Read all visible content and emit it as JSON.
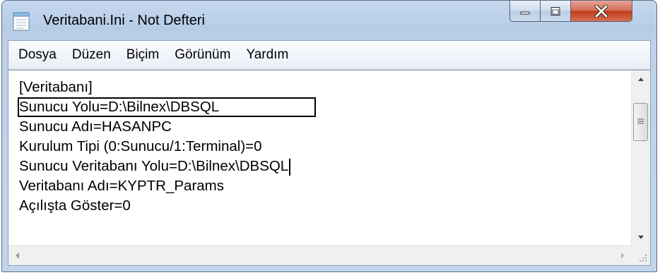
{
  "window": {
    "title": "Veritabani.Ini - Not Defteri",
    "app_icon": "notepad-icon",
    "controls": {
      "minimize_icon": "minimize-icon",
      "maximize_icon": "maximize-icon",
      "close_icon": "close-icon"
    }
  },
  "menu": {
    "items": [
      "Dosya",
      "Düzen",
      "Biçim",
      "Görünüm",
      "Yardım"
    ]
  },
  "editor": {
    "lines": [
      "[Veritabanı]",
      "Sunucu Yolu=D:\\Bilnex\\DBSQL",
      "Sunucu Adı=HASANPC",
      "Kurulum Tipi (0:Sunucu/1:Terminal)=0",
      "Sunucu Veritabanı Yolu=D:\\Bilnex\\DBSQL",
      "Veritabanı Adı=KYPTR_Params",
      "Açılışta Göster=0"
    ],
    "highlighted_line_index": 1,
    "caret_line_index": 4
  },
  "scrollbars": {
    "vertical": {
      "up_icon": "scroll-up-arrow-icon",
      "down_icon": "scroll-down-arrow-icon",
      "thumb_grip_icon": "scroll-grip-icon"
    },
    "horizontal": {
      "left_icon": "scroll-left-arrow-icon",
      "right_icon": "scroll-right-arrow-icon"
    },
    "size_grip_icon": "size-grip-icon"
  },
  "colors": {
    "title_bar": "#bdd1e8",
    "close_button": "#c9472a",
    "menu_bar": "#f0f4fa",
    "text": "#000000"
  }
}
